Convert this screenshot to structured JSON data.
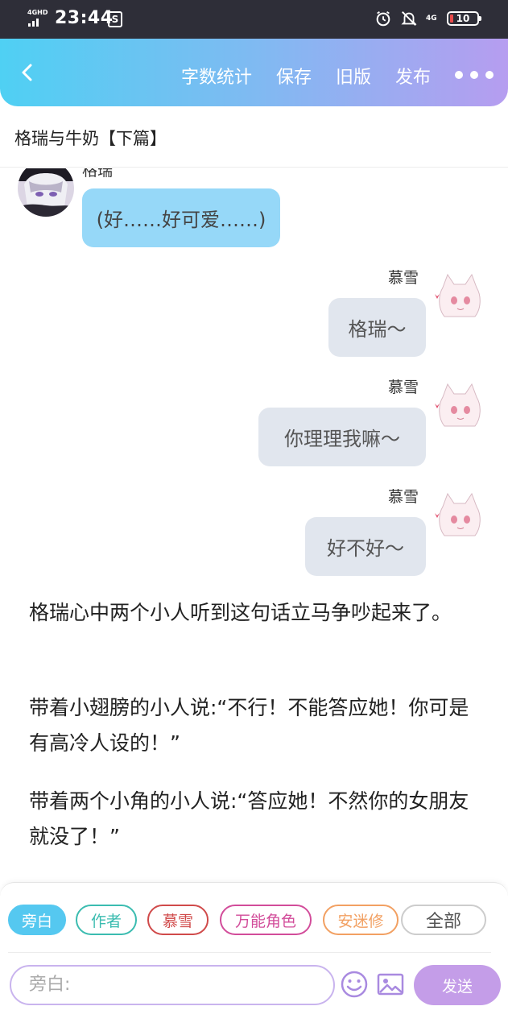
{
  "status_bar": {
    "network": "4GHD",
    "time": "23:44",
    "notification": "S",
    "right_network": "4G",
    "battery": "10",
    "battery_color": "#e84a4a"
  },
  "header": {
    "actions": [
      "字数统计",
      "保存",
      "旧版",
      "发布"
    ],
    "gradient": [
      "#4fd0f3",
      "#b69df0"
    ]
  },
  "title": "格瑞与牛奶【下篇】",
  "chat": {
    "messages": [
      {
        "side": "left",
        "name": "格瑞",
        "text": "(好……好可爱……)"
      },
      {
        "side": "right",
        "name": "慕雪",
        "text": "格瑞～"
      },
      {
        "side": "right",
        "name": "慕雪",
        "text": "你理理我嘛～"
      },
      {
        "side": "right",
        "name": "慕雪",
        "text": "好不好～"
      }
    ],
    "narration": [
      "格瑞心中两个小人听到这句话立马争吵起来了。",
      "带着小翅膀的小人说:“不行！不能答应她！你可是有高冷人设的！”",
      "带着两个小角的小人说:“答应她！不然你的女朋友就没了！”"
    ]
  },
  "roles": [
    {
      "label": "旁白",
      "color": "#55c8f0",
      "active": true
    },
    {
      "label": "作者",
      "color": "#3bbcb0",
      "active": false
    },
    {
      "label": "慕雪",
      "color": "#d04a4a",
      "active": false
    },
    {
      "label": "万能角色",
      "color": "#d24c9a",
      "active": false
    },
    {
      "label": "安迷修",
      "color": "#f2a062",
      "active": false
    },
    {
      "label": "全部",
      "color": "#cccccc",
      "active": false
    }
  ],
  "composer": {
    "placeholder": "旁白:",
    "send_label": "发送",
    "accent": "#c49de8"
  }
}
